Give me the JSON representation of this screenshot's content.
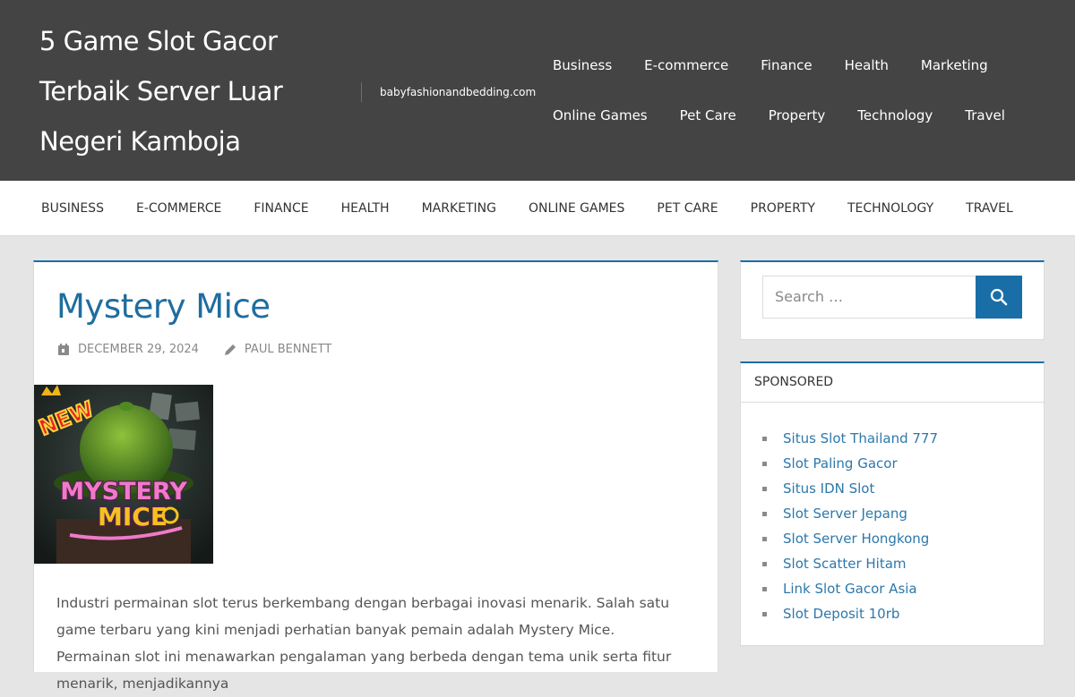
{
  "header": {
    "site_title": "5 Game Slot Gacor Terbaik Server Luar Negeri Kamboja",
    "site_description": "babyfashionandbedding.com",
    "nav": [
      "Business",
      "E-commerce",
      "Finance",
      "Health",
      "Marketing",
      "Online Games",
      "Pet Care",
      "Property",
      "Technology",
      "Travel"
    ]
  },
  "main_nav": [
    "Business",
    "E-commerce",
    "Finance",
    "Health",
    "Marketing",
    "Online Games",
    "Pet Care",
    "Property",
    "Technology",
    "Travel"
  ],
  "post": {
    "title": "Mystery Mice",
    "date": "December 29, 2024",
    "author": "Paul Bennett",
    "image_badge": "NEW",
    "image_logo_line1": "MYSTERY",
    "image_logo_line2": "MICE",
    "excerpt": "Industri permainan slot terus berkembang dengan berbagai inovasi menarik. Salah satu game terbaru yang kini menjadi perhatian banyak pemain adalah Mystery Mice. Permainan slot ini menawarkan pengalaman yang berbeda dengan tema unik serta fitur menarik, menjadikannya"
  },
  "sidebar": {
    "search_placeholder": "Search …",
    "sponsored_title": "Sponsored",
    "sponsored_links": [
      "Situs Slot Thailand 777",
      "Slot Paling Gacor",
      "Situs IDN Slot",
      "Slot Server Jepang",
      "Slot Server Hongkong",
      "Slot Scatter Hitam",
      "Link Slot Gacor Asia",
      "Slot Deposit 10rb"
    ]
  },
  "colors": {
    "header_bg": "#444444",
    "accent": "#1a6ea8",
    "title_blue": "#1f6d9f",
    "link_blue": "#2d78ab"
  }
}
